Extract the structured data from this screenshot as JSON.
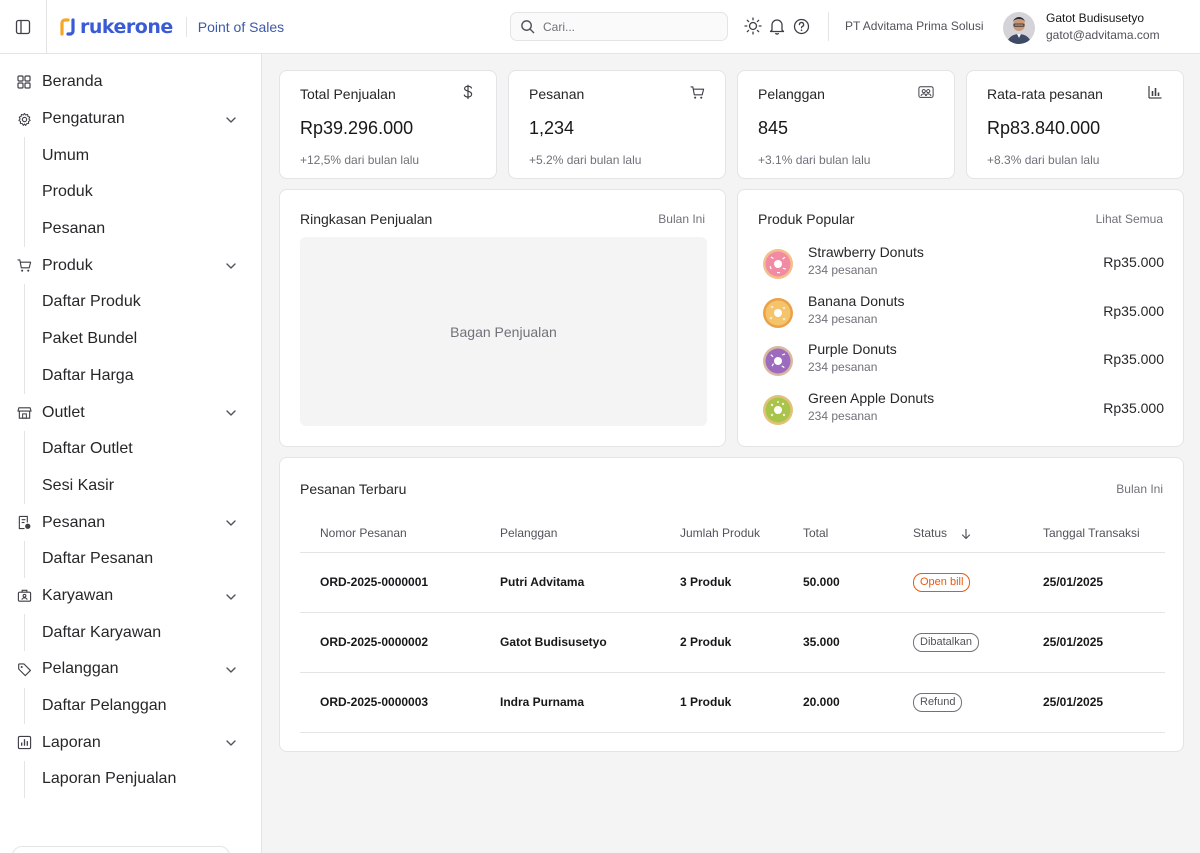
{
  "header": {
    "brand": "rukerone",
    "app_name": "Point of Sales",
    "search_placeholder": "Cari...",
    "company": "PT Advitama Prima Solusi",
    "user_name": "Gatot Budisusetyo",
    "user_email": "gatot@advitama.com"
  },
  "sidebar": {
    "beranda": "Beranda",
    "pengaturan": {
      "label": "Pengaturan",
      "items": [
        "Umum",
        "Produk",
        "Pesanan"
      ]
    },
    "produk": {
      "label": "Produk",
      "items": [
        "Daftar Produk",
        "Paket Bundel",
        "Daftar Harga"
      ]
    },
    "outlet": {
      "label": "Outlet",
      "items": [
        "Daftar Outlet",
        "Sesi Kasir"
      ]
    },
    "pesanan": {
      "label": "Pesanan",
      "items": [
        "Daftar Pesanan"
      ]
    },
    "karyawan": {
      "label": "Karyawan",
      "items": [
        "Daftar Karyawan"
      ]
    },
    "pelanggan": {
      "label": "Pelanggan",
      "items": [
        "Daftar Pelanggan"
      ]
    },
    "laporan": {
      "label": "Laporan",
      "items": [
        "Laporan Penjualan"
      ]
    }
  },
  "stats": [
    {
      "title": "Total Penjualan",
      "value": "Rp39.296.000",
      "change": "+12,5% dari bulan lalu",
      "icon": "dollar-icon"
    },
    {
      "title": "Pesanan",
      "value": "1,234",
      "change": "+5.2% dari bulan lalu",
      "icon": "cart-icon"
    },
    {
      "title": "Pelanggan",
      "value": "845",
      "change": "+3.1% dari bulan lalu",
      "icon": "users-icon"
    },
    {
      "title": "Rata-rata pesanan",
      "value": "Rp83.840.000",
      "change": "+8.3% dari bulan lalu",
      "icon": "bar-chart-icon"
    }
  ],
  "sales_summary": {
    "title": "Ringkasan Penjualan",
    "period": "Bulan Ini",
    "placeholder": "Bagan Penjualan"
  },
  "popular": {
    "title": "Produk Popular",
    "link": "Lihat Semua",
    "items": [
      {
        "name": "Strawberry Donuts",
        "orders": "234 pesanan",
        "price": "Rp35.000",
        "color": "#f4a6b6"
      },
      {
        "name": "Banana Donuts",
        "orders": "234 pesanan",
        "price": "Rp35.000",
        "color": "#f2b45a"
      },
      {
        "name": "Purple Donuts",
        "orders": "234 pesanan",
        "price": "Rp35.000",
        "color": "#a77bc4"
      },
      {
        "name": "Green Apple Donuts",
        "orders": "234 pesanan",
        "price": "Rp35.000",
        "color": "#a7c24a"
      }
    ]
  },
  "recent_orders": {
    "title": "Pesanan Terbaru",
    "period": "Bulan Ini",
    "columns": [
      "Nomor Pesanan",
      "Pelanggan",
      "Jumlah Produk",
      "Total",
      "Status",
      "Tanggal Transaksi"
    ],
    "rows": [
      {
        "id": "ORD-2025-0000001",
        "customer": "Putri Advitama",
        "qty": "3 Produk",
        "total": "50.000",
        "status": "Open bill",
        "date": "25/01/2025"
      },
      {
        "id": "ORD-2025-0000002",
        "customer": "Gatot Budisusetyo",
        "qty": "2 Produk",
        "total": "35.000",
        "status": "Dibatalkan",
        "date": "25/01/2025"
      },
      {
        "id": "ORD-2025-0000003",
        "customer": "Indra Purnama",
        "qty": "1 Produk",
        "total": "20.000",
        "status": "Refund",
        "date": "25/01/2025"
      }
    ]
  }
}
